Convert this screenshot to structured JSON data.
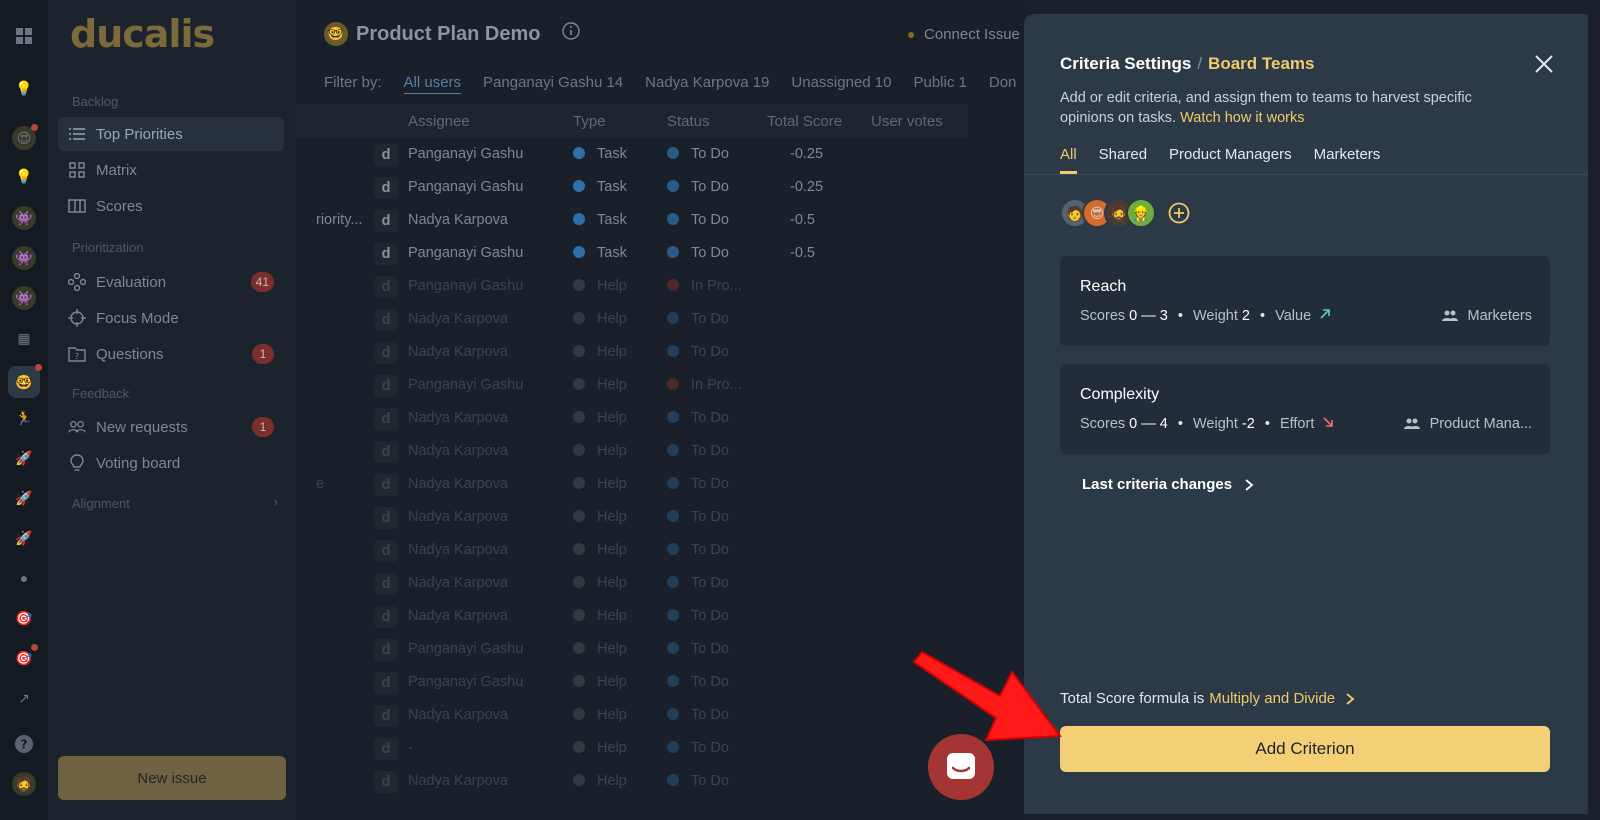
{
  "sidebar": {
    "logo": "ducalis",
    "sections": {
      "backlog": "Backlog",
      "prioritization": "Prioritization",
      "feedback": "Feedback",
      "alignment": "Alignment"
    },
    "items": [
      {
        "label": "Top Priorities",
        "icon": "list-icon"
      },
      {
        "label": "Matrix",
        "icon": "grid-icon"
      },
      {
        "label": "Scores",
        "icon": "table-icon"
      },
      {
        "label": "Evaluation",
        "icon": "nodes-icon",
        "badge": "41"
      },
      {
        "label": "Focus Mode",
        "icon": "crosshair-icon"
      },
      {
        "label": "Questions",
        "icon": "folder-question-icon",
        "badge": "1"
      },
      {
        "label": "New requests",
        "icon": "users-icon",
        "badge": "1"
      },
      {
        "label": "Voting board",
        "icon": "lightbulb-icon"
      }
    ],
    "new_issue_label": "New issue"
  },
  "main": {
    "title": "Product Plan Demo",
    "connect_label": "Connect Issue",
    "filter_label": "Filter by:",
    "filters": [
      "All users",
      "Panganayi Gashu 14",
      "Nadya Karpova 19",
      "Unassigned 10",
      "Public 1",
      "Don"
    ],
    "columns": [
      "Assignee",
      "Type",
      "Status",
      "Total Score",
      "User votes"
    ],
    "rows": [
      {
        "title": "",
        "assignee": "Panganayi Gashu",
        "type": "Task",
        "status": "To Do",
        "score": "-0.25"
      },
      {
        "title": "",
        "assignee": "Panganayi Gashu",
        "type": "Task",
        "status": "To Do",
        "score": "-0.25"
      },
      {
        "title": "riority...",
        "assignee": "Nadya Karpova",
        "type": "Task",
        "status": "To Do",
        "score": "-0.5"
      },
      {
        "title": "",
        "assignee": "Panganayi Gashu",
        "type": "Task",
        "status": "To Do",
        "score": "-0.5"
      },
      {
        "title": "",
        "assignee": "Panganayi Gashu",
        "type": "Help",
        "status": "In Pro...",
        "score": ""
      },
      {
        "title": "",
        "assignee": "Nadya Karpova",
        "type": "Help",
        "status": "To Do",
        "score": ""
      },
      {
        "title": "",
        "assignee": "Nadya Karpova",
        "type": "Help",
        "status": "To Do",
        "score": ""
      },
      {
        "title": "",
        "assignee": "Panganayi Gashu",
        "type": "Help",
        "status": "In Pro...",
        "score": ""
      },
      {
        "title": "",
        "assignee": "Nadya Karpova",
        "type": "Help",
        "status": "To Do",
        "score": ""
      },
      {
        "title": "",
        "assignee": "Nadya Karpova",
        "type": "Help",
        "status": "To Do",
        "score": ""
      },
      {
        "title": "e",
        "assignee": "Nadya Karpova",
        "type": "Help",
        "status": "To Do",
        "score": ""
      },
      {
        "title": "",
        "assignee": "Nadya Karpova",
        "type": "Help",
        "status": "To Do",
        "score": ""
      },
      {
        "title": "",
        "assignee": "Nadya Karpova",
        "type": "Help",
        "status": "To Do",
        "score": ""
      },
      {
        "title": "",
        "assignee": "Nadya Karpova",
        "type": "Help",
        "status": "To Do",
        "score": ""
      },
      {
        "title": "",
        "assignee": "Nadya Karpova",
        "type": "Help",
        "status": "To Do",
        "score": ""
      },
      {
        "title": "",
        "assignee": "Panganayi Gashu",
        "type": "Help",
        "status": "To Do",
        "score": ""
      },
      {
        "title": "",
        "assignee": "Panganayi Gashu",
        "type": "Help",
        "status": "To Do",
        "score": ""
      },
      {
        "title": "",
        "assignee": "Nadya Karpova",
        "type": "Help",
        "status": "To Do",
        "score": ""
      },
      {
        "title": "",
        "assignee": "-",
        "type": "Help",
        "status": "To Do",
        "score": ""
      },
      {
        "title": "",
        "assignee": "Nadya Karpova",
        "type": "Help",
        "status": "To Do",
        "score": ""
      }
    ]
  },
  "panel": {
    "title": "Criteria Settings",
    "separator": "/",
    "team": "Board Teams",
    "description": "Add or edit criteria, and assign them to teams to harvest specific opinions on tasks.",
    "watch_link": "Watch how it works",
    "tabs": [
      "All",
      "Shared",
      "Product Managers",
      "Marketers"
    ],
    "criteria": [
      {
        "name": "Reach",
        "scores_label": "Scores",
        "scores_range": "0 — 3",
        "weight_label": "Weight",
        "weight": "2",
        "kind": "Value",
        "team": "Marketers"
      },
      {
        "name": "Complexity",
        "scores_label": "Scores",
        "scores_range": "0 — 4",
        "weight_label": "Weight",
        "weight": "-2",
        "kind": "Effort",
        "team": "Product Mana..."
      }
    ],
    "last_changes_label": "Last criteria changes",
    "formula_prefix": "Total Score formula is",
    "formula_link": "Multiply and Divide",
    "add_button": "Add Criterion"
  },
  "colors": {
    "accent": "#f3cf76",
    "panel_bg": "#2c3947",
    "value_arrow": "#4fd1c5",
    "effort_arrow": "#ff6b6b",
    "annotation_arrow": "#ff1a1a",
    "chat_button": "#a53535"
  }
}
